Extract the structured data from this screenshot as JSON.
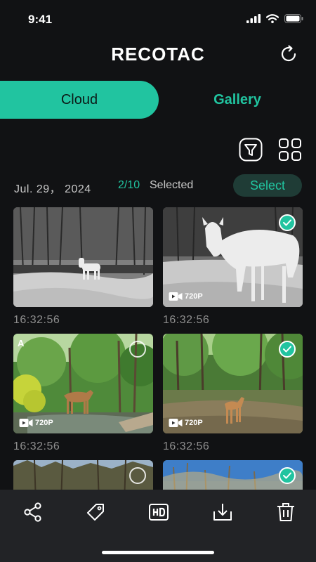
{
  "status": {
    "time": "9:41"
  },
  "header": {
    "title": "RECOTAC"
  },
  "tabs": {
    "cloud": "Cloud",
    "gallery": "Gallery"
  },
  "info": {
    "date": "Jul. 29， 2024",
    "count": "2/10",
    "selected_label": "Selected",
    "select_button": "Select"
  },
  "media": [
    {
      "time": "16:32:56",
      "scene": "night-snow-deer",
      "selected": false,
      "video": false,
      "resolution": ""
    },
    {
      "time": "16:32:56",
      "scene": "night-deer-closeup",
      "selected": true,
      "video": true,
      "resolution": "720P"
    },
    {
      "time": "16:32:56",
      "scene": "day-stream-deer",
      "selected": false,
      "video": true,
      "resolution": "720P",
      "corner_label": "A"
    },
    {
      "time": "16:32:56",
      "scene": "day-forest-fawn",
      "selected": true,
      "video": true,
      "resolution": "720P"
    },
    {
      "time": "",
      "scene": "day-trees",
      "selected": false,
      "video": false,
      "resolution": ""
    },
    {
      "time": "",
      "scene": "day-sky-trees",
      "selected": true,
      "video": false,
      "resolution": ""
    }
  ],
  "colors": {
    "accent": "#21c4a0",
    "background": "#111214",
    "bottom_bar": "#222326"
  },
  "bottom_actions": [
    "share-icon",
    "tag-icon",
    "hd-icon",
    "download-icon",
    "delete-icon"
  ]
}
